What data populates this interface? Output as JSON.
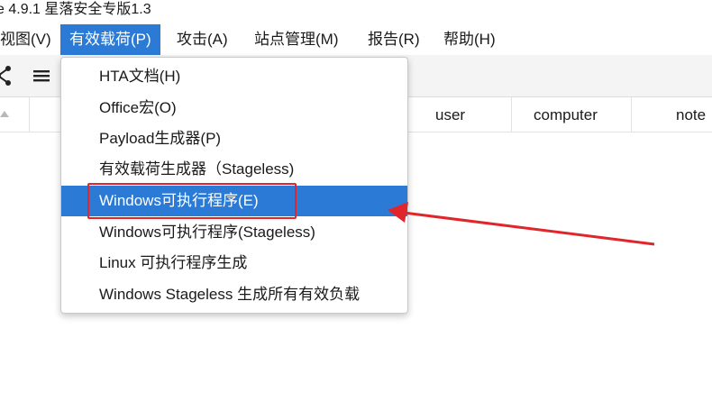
{
  "window": {
    "title": "e 4.9.1 星落安全专版1.3"
  },
  "menubar": {
    "items": [
      "视图(V)",
      "有效载荷(P)",
      "攻击(A)",
      "站点管理(M)",
      "报告(R)",
      "帮助(H)"
    ],
    "active": "有效载荷(P)"
  },
  "toolbar": {
    "icons": [
      "share-icon",
      "menu-icon"
    ]
  },
  "table": {
    "columns": [
      "user",
      "computer",
      "note"
    ]
  },
  "dropdown": {
    "items": [
      "HTA文档(H)",
      "Office宏(O)",
      "Payload生成器(P)",
      "有效载荷生成器（Stageless)",
      "Windows可执行程序(E)",
      "Windows可执行程序(Stageless)",
      "Linux 可执行程序生成",
      "Windows Stageless 生成所有有效负载"
    ],
    "selected": "Windows可执行程序(E)"
  },
  "colors": {
    "accent": "#2b7bd6",
    "annotation": "#e0262a"
  }
}
